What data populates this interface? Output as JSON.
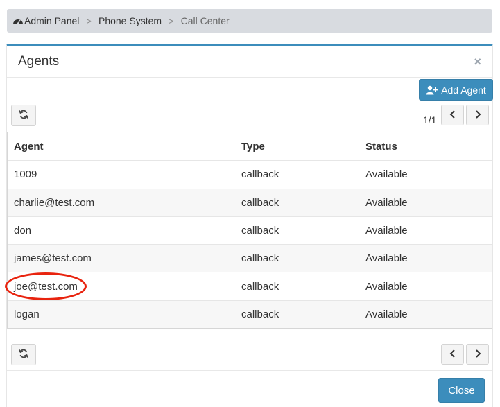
{
  "breadcrumb": {
    "items": [
      {
        "label": "Admin Panel"
      },
      {
        "label": "Phone System"
      },
      {
        "label": "Call Center"
      }
    ]
  },
  "panel": {
    "title": "Agents",
    "close_x": "×",
    "add_agent_label": "Add Agent",
    "pager": "1/1",
    "close_button_label": "Close"
  },
  "table": {
    "headers": [
      "Agent",
      "Type",
      "Status"
    ],
    "rows": [
      [
        "1009",
        "callback",
        "Available"
      ],
      [
        "charlie@test.com",
        "callback",
        "Available"
      ],
      [
        "don",
        "callback",
        "Available"
      ],
      [
        "james@test.com",
        "callback",
        "Available"
      ],
      [
        "joe@test.com",
        "callback",
        "Available"
      ],
      [
        "logan",
        "callback",
        "Available"
      ]
    ]
  },
  "icons": {
    "dashboard": "dashboard-icon",
    "add_user": "user-plus-icon",
    "refresh": "refresh-icon",
    "prev": "chevron-left-icon",
    "next": "chevron-right-icon"
  },
  "colors": {
    "accent": "#3c8dbc",
    "highlight": "#e8230e"
  }
}
